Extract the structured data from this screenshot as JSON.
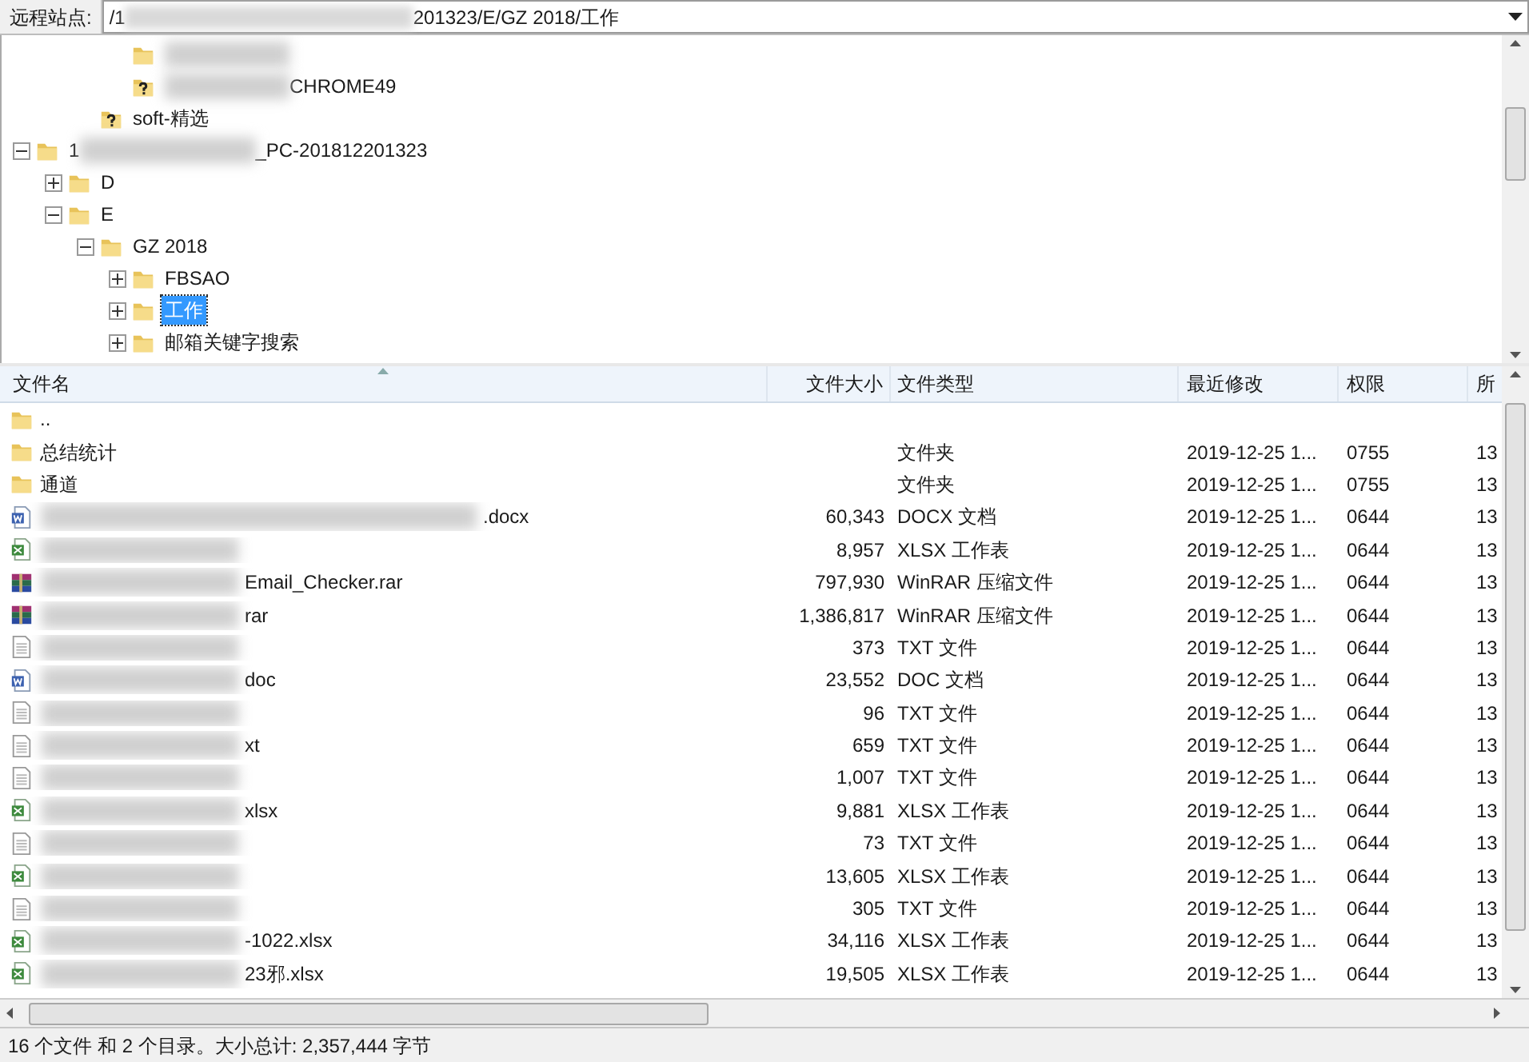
{
  "address_bar": {
    "label": "远程站点:",
    "path_start": "/1",
    "path_end": "201323/E/GZ 2018/工作"
  },
  "tree": {
    "items": [
      {
        "kind": "offscreen",
        "children": [
          {
            "kind": "offscreen",
            "children": [
              {
                "kind": "offscreen",
                "children": [
                  {
                    "kind": "folder",
                    "selected": false
                  },
                  {
                    "kind": "unknown",
                    "label_end": "CHROME49",
                    "selected": false
                  }
                ]
              },
              {
                "kind": "unknown",
                "label": "soft-精选",
                "selected": false
              }
            ]
          }
        ]
      },
      {
        "kind": "folder",
        "label": "1",
        "label_end": "_PC-201812201323",
        "expanded": true,
        "selected": false,
        "children": [
          {
            "kind": "folder",
            "label": "D",
            "expanded": false,
            "selected": false
          },
          {
            "kind": "folder",
            "label": "E",
            "expanded": true,
            "selected": false,
            "children": [
              {
                "kind": "folder",
                "label": "GZ 2018",
                "expanded": true,
                "selected": false,
                "children": [
                  {
                    "kind": "folder",
                    "label": "FBSAO",
                    "expanded": false,
                    "selected": false
                  },
                  {
                    "kind": "folder",
                    "label": "工作",
                    "expanded": false,
                    "selected": true
                  },
                  {
                    "kind": "folder",
                    "label": "邮箱关键字搜索",
                    "expanded": false,
                    "selected": false
                  }
                ]
              }
            ]
          }
        ]
      }
    ]
  },
  "table": {
    "columns": [
      "文件名",
      "文件大小",
      "文件类型",
      "最近修改",
      "权限",
      "所"
    ],
    "rows": [
      {
        "kind": "folder",
        "name": ".."
      },
      {
        "kind": "folder",
        "name": "总结统计",
        "type": "文件夹",
        "modified": "2019-12-25 1...",
        "permissions": "0755",
        "owner": "13"
      },
      {
        "kind": "folder",
        "name": "通道",
        "type": "文件夹",
        "modified": "2019-12-25 1...",
        "permissions": "0755",
        "owner": "13"
      },
      {
        "kind": "word",
        "name": ".docx",
        "size": "60,343",
        "type": "DOCX 文档",
        "modified": "2019-12-25 1...",
        "permissions": "0644",
        "owner": "13"
      },
      {
        "kind": "excel",
        "size": "8,957",
        "type": "XLSX 工作表",
        "modified": "2019-12-25 1...",
        "permissions": "0644",
        "owner": "13"
      },
      {
        "kind": "rar",
        "name": "Email_Checker.rar",
        "size": "797,930",
        "type": "WinRAR 压缩文件",
        "modified": "2019-12-25 1...",
        "permissions": "0644",
        "owner": "13"
      },
      {
        "kind": "rar",
        "name": "rar",
        "size": "1,386,817",
        "type": "WinRAR 压缩文件",
        "modified": "2019-12-25 1...",
        "permissions": "0644",
        "owner": "13"
      },
      {
        "kind": "text",
        "size": "373",
        "type": "TXT 文件",
        "modified": "2019-12-25 1...",
        "permissions": "0644",
        "owner": "13"
      },
      {
        "kind": "word",
        "name": "doc",
        "size": "23,552",
        "type": "DOC 文档",
        "modified": "2019-12-25 1...",
        "permissions": "0644",
        "owner": "13"
      },
      {
        "kind": "text",
        "size": "96",
        "type": "TXT 文件",
        "modified": "2019-12-25 1...",
        "permissions": "0644",
        "owner": "13"
      },
      {
        "kind": "text",
        "name": "xt",
        "size": "659",
        "type": "TXT 文件",
        "modified": "2019-12-25 1...",
        "permissions": "0644",
        "owner": "13"
      },
      {
        "kind": "text",
        "size": "1,007",
        "type": "TXT 文件",
        "modified": "2019-12-25 1...",
        "permissions": "0644",
        "owner": "13"
      },
      {
        "kind": "excel",
        "name": "xlsx",
        "size": "9,881",
        "type": "XLSX 工作表",
        "modified": "2019-12-25 1...",
        "permissions": "0644",
        "owner": "13"
      },
      {
        "kind": "text",
        "size": "73",
        "type": "TXT 文件",
        "modified": "2019-12-25 1...",
        "permissions": "0644",
        "owner": "13"
      },
      {
        "kind": "excel",
        "size": "13,605",
        "type": "XLSX 工作表",
        "modified": "2019-12-25 1...",
        "permissions": "0644",
        "owner": "13"
      },
      {
        "kind": "text",
        "size": "305",
        "type": "TXT 文件",
        "modified": "2019-12-25 1...",
        "permissions": "0644",
        "owner": "13"
      },
      {
        "kind": "excel",
        "name": "-1022.xlsx",
        "size": "34,116",
        "type": "XLSX 工作表",
        "modified": "2019-12-25 1...",
        "permissions": "0644",
        "owner": "13"
      },
      {
        "kind": "excel",
        "name": "23邪.xlsx",
        "size": "19,505",
        "type": "XLSX 工作表",
        "modified": "2019-12-25 1...",
        "permissions": "0644",
        "owner": "13"
      }
    ]
  },
  "status_bar": {
    "text": "16 个文件 和 2 个目录。大小总计: 2,357,444 字节"
  }
}
